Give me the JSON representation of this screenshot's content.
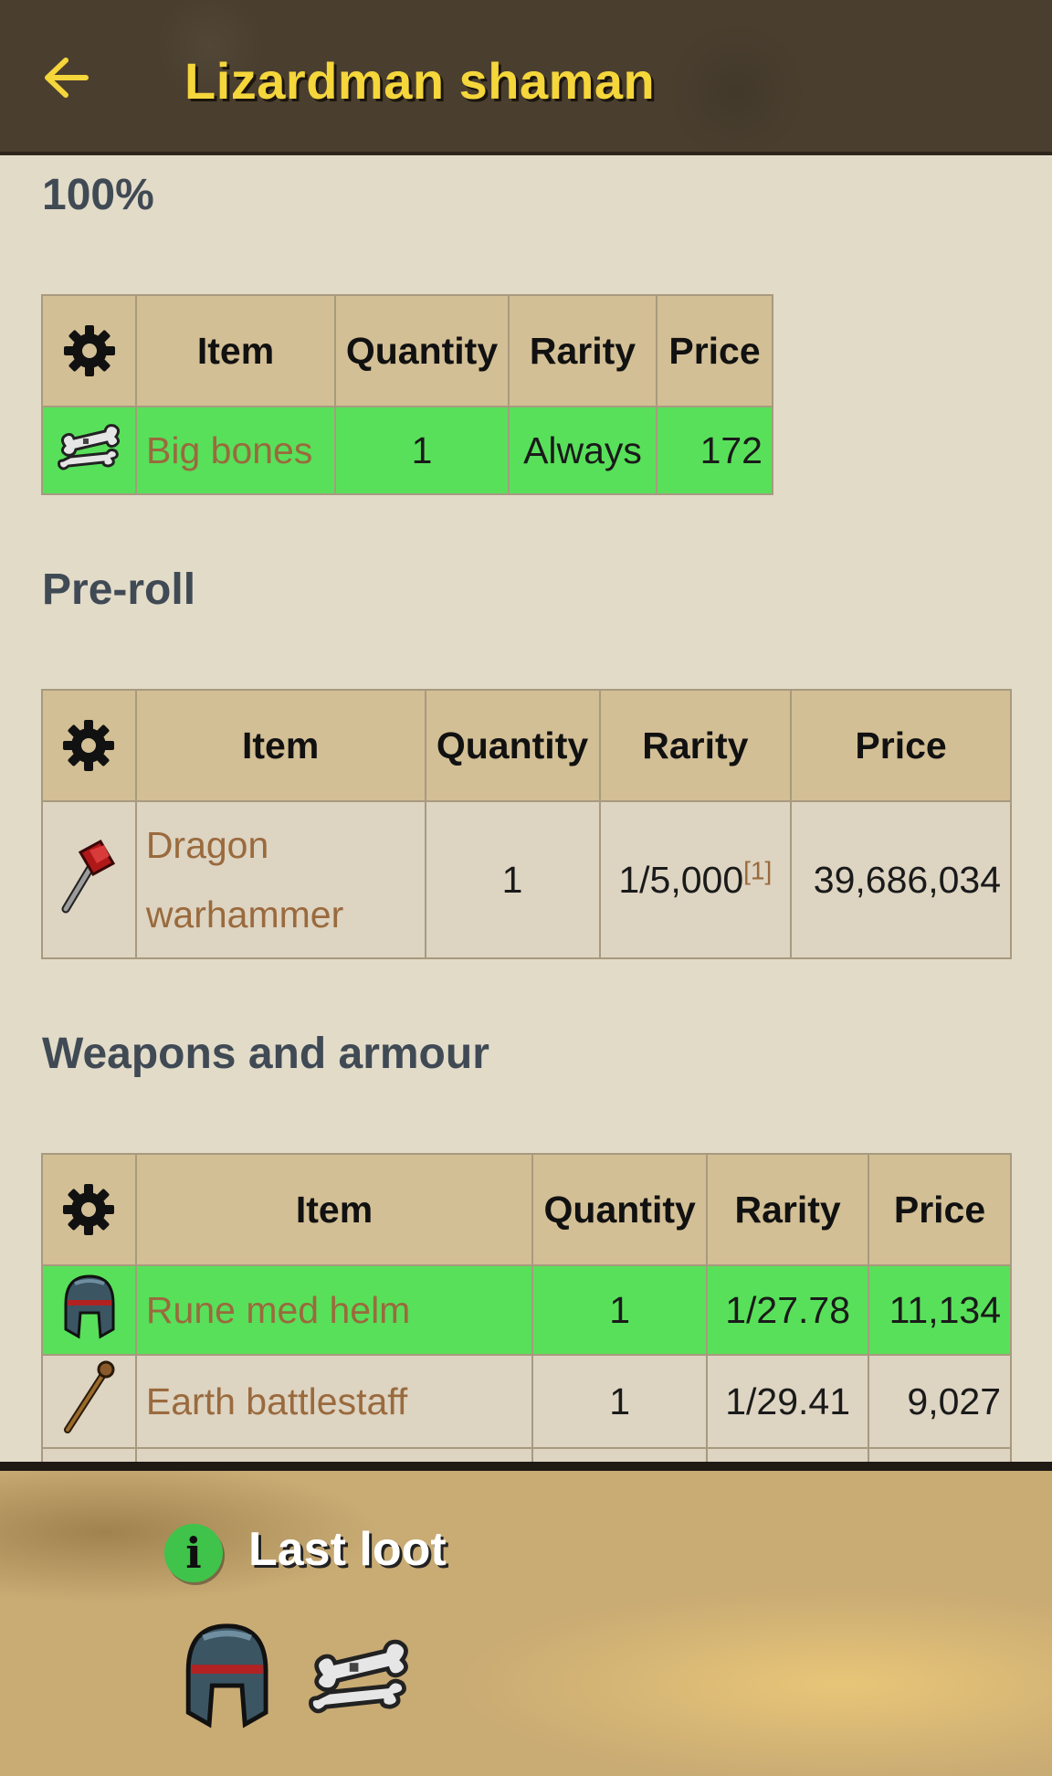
{
  "header": {
    "title": "Lizardman shaman"
  },
  "sections": [
    {
      "heading": "100%",
      "columns": [
        "Item",
        "Quantity",
        "Rarity",
        "Price"
      ],
      "rows": [
        {
          "icon": "big-bones-icon",
          "item": "Big bones",
          "quantity": "1",
          "rarity": "Always",
          "price": "172",
          "highlight": true
        }
      ]
    },
    {
      "heading": "Pre-roll",
      "columns": [
        "Item",
        "Quantity",
        "Rarity",
        "Price"
      ],
      "rows": [
        {
          "icon": "dragon-warhammer-icon",
          "item": "Dragon warhammer",
          "quantity": "1",
          "rarity": "1/5,000",
          "rarity_ref": "[1]",
          "price": "39,686,034",
          "highlight": false
        }
      ]
    },
    {
      "heading": "Weapons and armour",
      "columns": [
        "Item",
        "Quantity",
        "Rarity",
        "Price"
      ],
      "rows": [
        {
          "icon": "rune-med-helm-icon",
          "item": "Rune med helm",
          "quantity": "1",
          "rarity": "1/27.78",
          "price": "11,134",
          "highlight": true
        },
        {
          "icon": "earth-battlestaff-icon",
          "item": "Earth battlestaff",
          "quantity": "1",
          "rarity": "1/29.41",
          "price": "9,027",
          "highlight": false
        }
      ]
    }
  ],
  "footer": {
    "info_glyph": "i",
    "title": "Last loot",
    "items": [
      "rune-med-helm-icon",
      "big-bones-icon"
    ]
  },
  "colors": {
    "highlight_row": "#58e05a",
    "header_bg": "#4a3f2f",
    "title": "#f5d63b",
    "link": "#9a6a3d",
    "table_header": "#d3bf95"
  }
}
